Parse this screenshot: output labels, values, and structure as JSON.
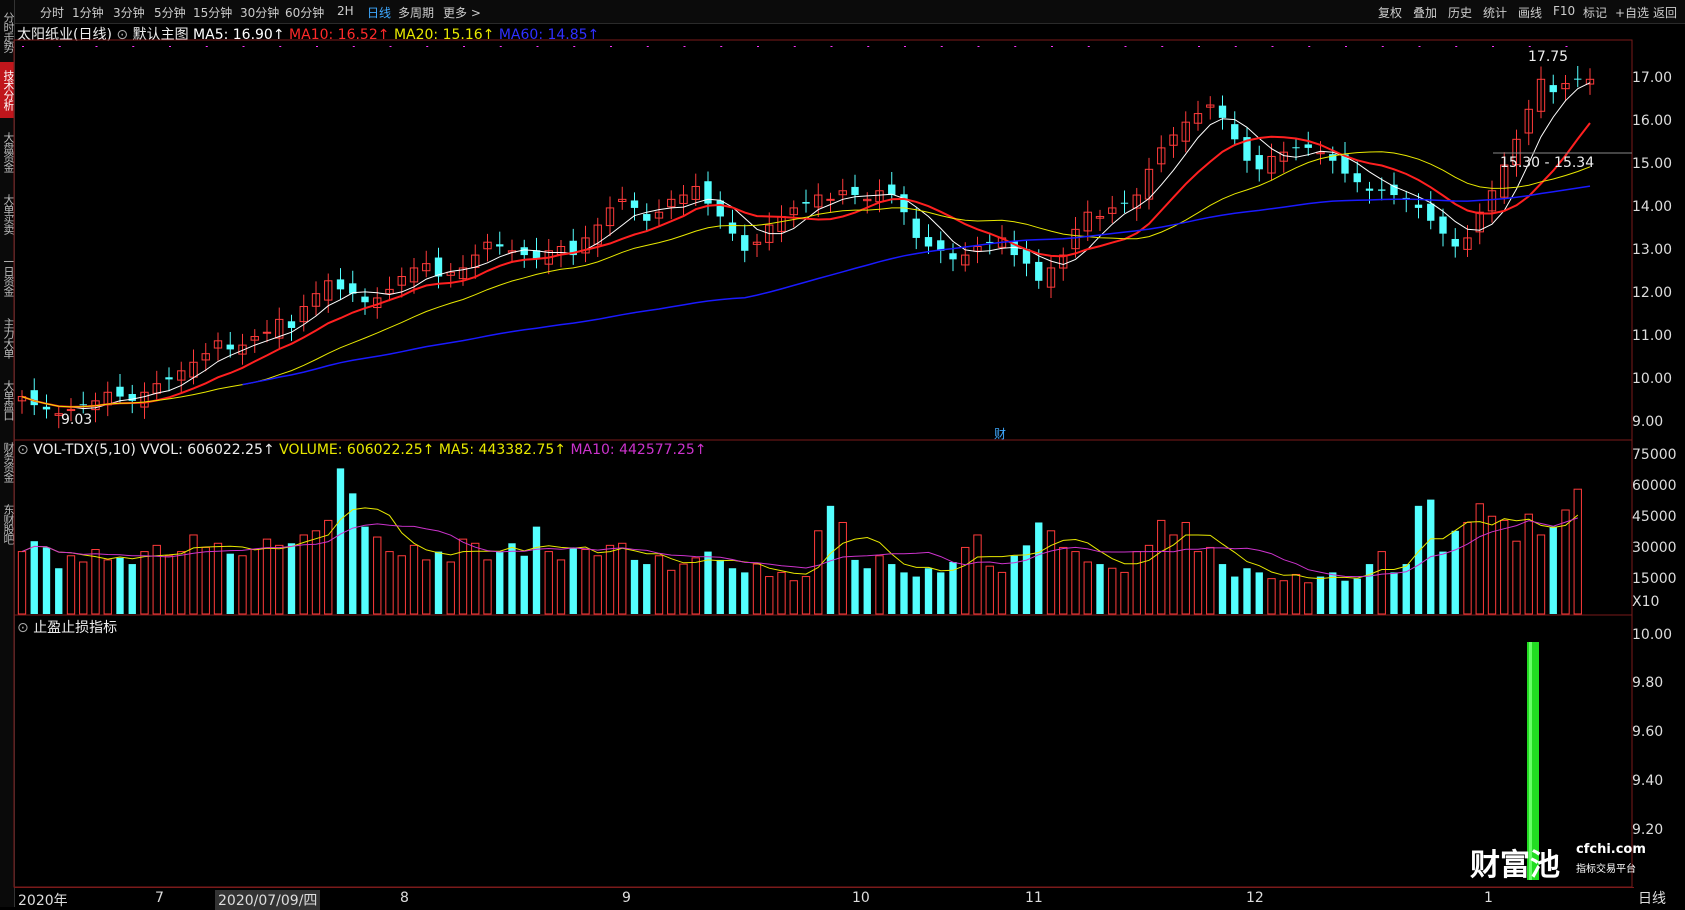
{
  "toolbar": {
    "periods": [
      "分时",
      "1分钟",
      "3分钟",
      "5分钟",
      "15分钟",
      "30分钟",
      "60分钟",
      "2H",
      "日线",
      "多周期",
      "更多 >"
    ],
    "active_period": "日线",
    "right_items": [
      "复权",
      "叠加",
      "历史",
      "统计",
      "画线",
      "F10",
      "标记",
      "+自选",
      "返回"
    ]
  },
  "sidebar": {
    "items": [
      "分时走势",
      "技术分析",
      "大盘资金",
      "大单买卖",
      "一日资金",
      "主力大单",
      "大单盘口",
      "财务资金",
      "东财股吧"
    ],
    "active": "技术分析"
  },
  "main_chart": {
    "title": "太阳纸业(日线)",
    "template": "默认主图",
    "ma5": "MA5: 16.90↑",
    "ma10": "MA10: 16.52↑",
    "ma20": "MA20: 15.16↑",
    "ma60": "MA60: 14.85↑",
    "high_label": "17.75",
    "low_label": "9.03",
    "range_label": "15.30 - 15.34",
    "cai_marker": "财",
    "y_ticks": [
      "17.00",
      "16.00",
      "15.00",
      "14.00",
      "13.00",
      "12.00",
      "11.00",
      "10.00",
      "9.00"
    ]
  },
  "volume_chart": {
    "title": "VOL-TDX(5,10)",
    "vvol": "VVOL: 606022.25↑",
    "volume": "VOLUME: 606022.25↑",
    "ma5": "MA5: 443382.75↑",
    "ma10": "MA10: 442577.25↑",
    "y_ticks": [
      "75000",
      "60000",
      "45000",
      "30000",
      "15000"
    ],
    "unit": "X10"
  },
  "indicator_chart": {
    "title": "止盈止损指标",
    "y_ticks": [
      "10.00",
      "9.80",
      "9.60",
      "9.40",
      "9.20"
    ]
  },
  "x_axis": {
    "labels": [
      "2020年",
      "7",
      "2020/07/09/四",
      "8",
      "9",
      "10",
      "11",
      "12",
      "1"
    ],
    "period_label": "日线"
  },
  "watermark": {
    "brand": "财富池",
    "site": "cfchi.com",
    "slogan": "指标交易平台"
  },
  "colors": {
    "up": "#ff3b3b",
    "down": "#54ffff",
    "ma5": "#ffffff",
    "ma10": "#ff2020",
    "ma20": "#e8e800",
    "ma60": "#1a1aff",
    "vol_ma5": "#e8e800",
    "vol_ma10": "#cc33cc",
    "signal": "#22dd22"
  },
  "chart_data": {
    "type": "candlestick",
    "title": "太阳纸业(日线)",
    "price_range": [
      8.8,
      17.8
    ],
    "close_series_approx": [
      9.5,
      9.3,
      9.2,
      9.1,
      9.2,
      9.3,
      9.4,
      9.6,
      9.5,
      9.4,
      9.6,
      9.8,
      9.9,
      10.1,
      10.3,
      10.5,
      10.8,
      10.6,
      10.7,
      10.9,
      11.0,
      11.3,
      11.1,
      11.6,
      11.9,
      12.2,
      12.0,
      11.9,
      11.7,
      11.8,
      12.0,
      12.3,
      12.5,
      12.6,
      12.3,
      12.4,
      12.5,
      12.8,
      13.1,
      13.0,
      12.9,
      12.8,
      12.7,
      12.9,
      13.0,
      12.8,
      13.2,
      13.5,
      13.9,
      14.1,
      13.9,
      13.6,
      13.8,
      14.1,
      14.2,
      14.4,
      14.0,
      13.7,
      13.3,
      12.9,
      13.1,
      13.5,
      13.7,
      13.9,
      14.0,
      14.2,
      14.1,
      14.3,
      14.2,
      14.1,
      14.3,
      14.2,
      13.8,
      13.2,
      13.0,
      12.9,
      12.7,
      12.8,
      13.0,
      13.1,
      13.2,
      12.8,
      12.6,
      12.2,
      12.5,
      12.8,
      13.4,
      13.8,
      13.7,
      13.9,
      14.0,
      14.2,
      14.8,
      15.3,
      15.6,
      15.9,
      16.1,
      16.3,
      16.0,
      15.5,
      15.0,
      14.8,
      15.1,
      15.2,
      15.3,
      15.3,
      15.2,
      15.0,
      14.7,
      14.5,
      14.3,
      14.3,
      14.2,
      14.1,
      13.9,
      13.6,
      13.3,
      13.0,
      13.2,
      13.8,
      14.3,
      14.9,
      15.5,
      16.2,
      16.9,
      16.6,
      16.8,
      16.9,
      16.9
    ],
    "volume_series_approx": [
      30,
      35,
      32,
      22,
      28,
      25,
      31,
      26,
      27,
      24,
      30,
      33,
      28,
      30,
      38,
      32,
      34,
      29,
      28,
      31,
      36,
      33,
      34,
      38,
      40,
      45,
      70,
      58,
      42,
      37,
      30,
      28,
      33,
      26,
      30,
      25,
      36,
      34,
      26,
      30,
      34,
      28,
      42,
      30,
      26,
      32,
      31,
      28,
      33,
      34,
      26,
      24,
      28,
      21,
      24,
      27,
      30,
      26,
      22,
      20,
      24,
      18,
      20,
      16,
      18,
      40,
      52,
      44,
      26,
      22,
      28,
      24,
      20,
      18,
      22,
      20,
      25,
      32,
      38,
      23,
      20,
      28,
      33,
      44,
      40,
      32,
      30,
      25,
      24,
      22,
      20,
      30,
      33,
      45,
      38,
      44,
      30,
      32,
      24,
      18,
      22,
      20,
      17,
      16,
      19,
      15,
      18,
      20,
      16,
      17,
      24,
      30,
      20,
      24,
      52,
      55,
      30,
      40,
      44,
      53,
      47,
      45,
      35,
      48,
      38,
      42,
      50,
      60
    ]
  }
}
